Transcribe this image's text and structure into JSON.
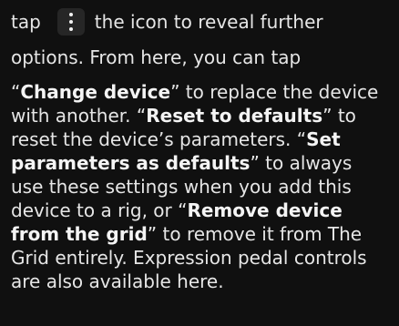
{
  "intro": {
    "before_icon": "tap",
    "icon": "more-vertical-icon",
    "after_icon": "the icon to reveal further",
    "line2": "options. From here, you can tap"
  },
  "body": {
    "q_open_1": "“",
    "change_device": "Change device",
    "t1": "” to replace the device with another. “",
    "reset_defaults": "Reset to defaults",
    "t2": "” to reset the device’s parameters. “",
    "set_defaults": "Set parameters as defaults",
    "t3": "” to always use these settings when you add this device to a rig, or “",
    "remove_device": "Remove device from the grid",
    "t4": "” to remove it from The Grid entirely. Expression pedal controls are also available here."
  }
}
